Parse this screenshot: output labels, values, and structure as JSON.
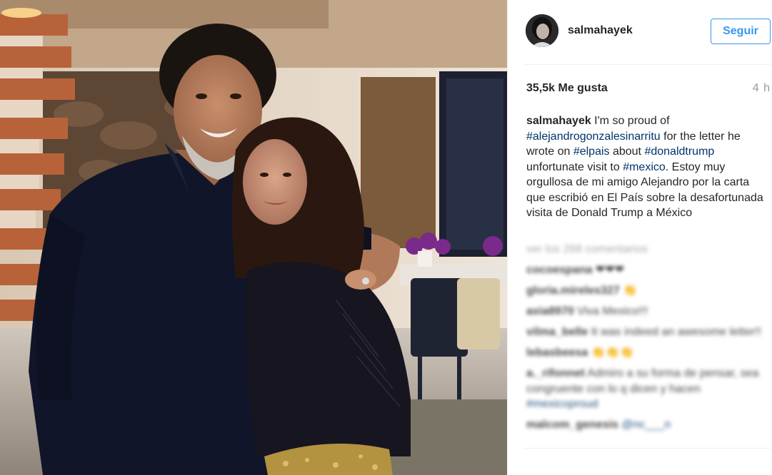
{
  "post": {
    "username": "salmahayek",
    "follow_label": "Seguir",
    "likes": "35,5k Me gusta",
    "time_ago": "4 h",
    "caption": {
      "user": "salmahayek",
      "t1": " I'm so proud of ",
      "tag1": "#alejandrogonzalesinarritu",
      "t2": " for the letter he wrote on ",
      "tag2": "#elpais",
      "t3": " about ",
      "tag3": "#donaldtrump",
      "t4": " unfortunate visit to ",
      "tag4": "#mexico",
      "t5": ". Estoy muy orgullosa de mi amigo Alejandro por la carta que escribió en El País sobre la desafortunada visita de Donald Trump a México"
    }
  },
  "comments": {
    "load_more": "ver los 268 comentarios",
    "items": [
      {
        "user": "cocoespana",
        "text": " ❤❤❤"
      },
      {
        "user": "gloria.mireles327",
        "text": " 👏"
      },
      {
        "user": "axia8970",
        "text": " Viva Mexico!!!"
      },
      {
        "user": "vilma_belle",
        "text": " It was indeed an awesome letter!!"
      },
      {
        "user": "lebasbeesa",
        "text": " 👏👏👏"
      },
      {
        "user": "a._rifonnet",
        "text": " Admiro a su forma de pensar, sea congruente con lo q dicen y hacen ",
        "tag": "#mexicoproud"
      },
      {
        "user": "malcom_genesis",
        "text": " ",
        "tag": "@nc___n"
      }
    ]
  },
  "colors": {
    "accent": "#3897f0",
    "hashtag": "#003569",
    "text": "#262626",
    "muted": "#999999",
    "divider": "#efefef"
  }
}
